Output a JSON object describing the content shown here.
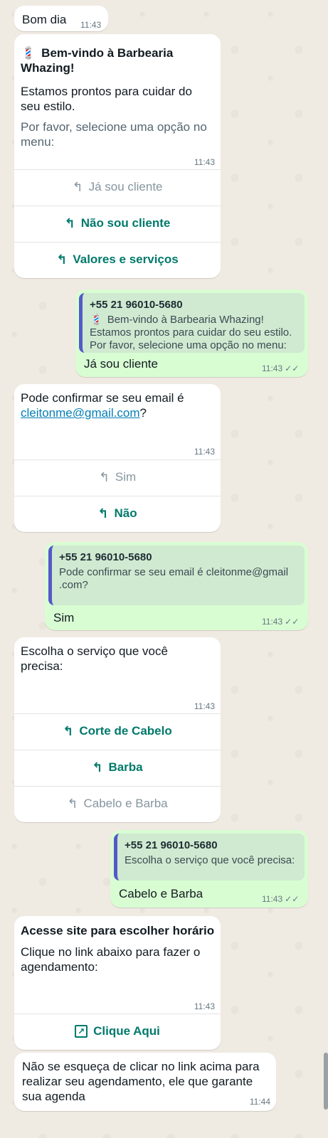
{
  "messages": {
    "m1": {
      "text": "Bom dia",
      "time": "11:43"
    },
    "m2": {
      "title_icon": "barber-pole-icon",
      "title": "Bem-vindo à Barbearia Whazing!",
      "line1": "Estamos prontos para cuidar do seu estilo.",
      "line2": "Por favor, selecione uma opção no menu:",
      "time": "11:43",
      "buttons": [
        "Já sou cliente",
        "Não sou cliente",
        "Valores e serviços"
      ]
    },
    "r1": {
      "quote_number": "+55 21 96010-5680",
      "quote_line1": "Bem-vindo à Barbearia Whazing!",
      "quote_line2": "Estamos prontos para cuidar do seu estilo.",
      "quote_line3": "Por favor, selecione uma opção no menu:",
      "reply": "Já sou cliente",
      "time": "11:43"
    },
    "m3": {
      "text_prefix": "Pode confirmar se seu email é",
      "email": "cleitonme@gmail.com",
      "text_suffix": "?",
      "time": "11:43",
      "buttons": [
        "Sim",
        "Não"
      ]
    },
    "r2": {
      "quote_number": "+55 21 96010-5680",
      "quote_line1": "Pode confirmar se seu email é cleitonme@gmail",
      "quote_line2": ".com?",
      "reply": "Sim",
      "time": "11:43"
    },
    "m4": {
      "text": "Escolha o serviço que você precisa:",
      "time": "11:43",
      "buttons": [
        "Corte de Cabelo",
        "Barba",
        "Cabelo e Barba"
      ]
    },
    "r3": {
      "quote_number": "+55 21 96010-5680",
      "quote_line1": "Escolha o serviço que você precisa:",
      "reply": "Cabelo e Barba",
      "time": "11:43"
    },
    "m5": {
      "title": "Acesse site para escolher horário",
      "text": "Clique no link abaixo para fazer o agendamento:",
      "time": "11:43",
      "button": "Clique Aqui"
    },
    "m6": {
      "text": "Não se esqueça de clicar no link acima para realizar seu agendamento, ele que garante sua agenda",
      "time": "11:44"
    }
  },
  "colors": {
    "accent": "#00796b",
    "quote_bar": "#5459c9",
    "outgoing": "#d9fdd3",
    "background": "#efeae2"
  }
}
